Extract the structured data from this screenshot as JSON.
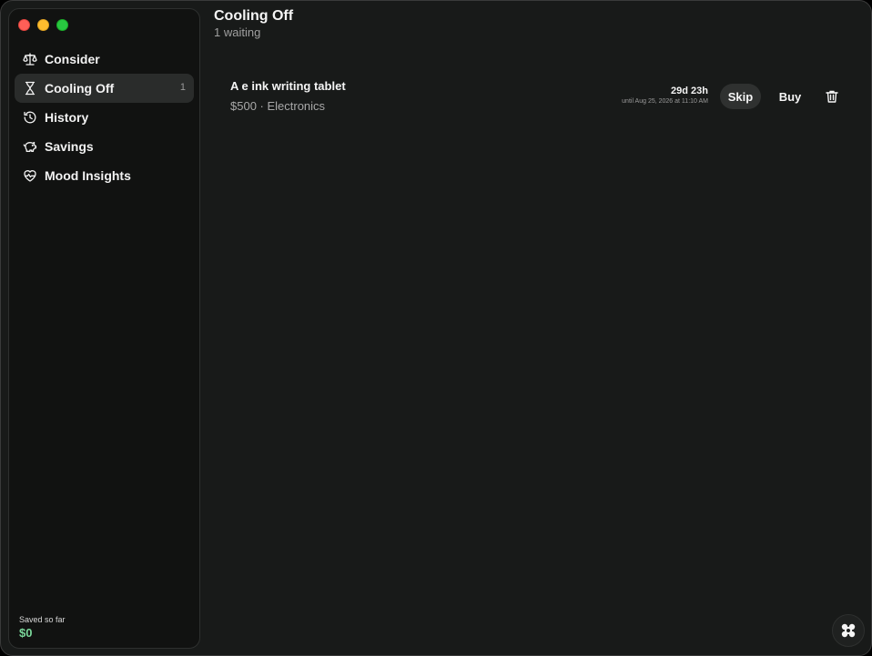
{
  "sidebar": {
    "items": [
      {
        "label": "Consider",
        "icon": "scale-icon",
        "count": ""
      },
      {
        "label": "Cooling Off",
        "icon": "hourglass-icon",
        "count": "1"
      },
      {
        "label": "History",
        "icon": "history-icon",
        "count": ""
      },
      {
        "label": "Savings",
        "icon": "piggy-bank-icon",
        "count": ""
      },
      {
        "label": "Mood Insights",
        "icon": "heart-pulse-icon",
        "count": ""
      }
    ],
    "saved_label": "Saved so far",
    "saved_value": "$0"
  },
  "header": {
    "title": "Cooling Off",
    "subtitle": "1 waiting"
  },
  "items": [
    {
      "name": "A e ink writing tablet",
      "meta": "$500 · Electronics",
      "countdown": "29d 23h",
      "until": "until Aug 25, 2026 at 11:10 AM",
      "skip_label": "Skip",
      "buy_label": "Buy"
    }
  ],
  "colors": {
    "accent_green": "#7bd89b",
    "background": "#181a19",
    "sidebar_bg": "#111211"
  }
}
